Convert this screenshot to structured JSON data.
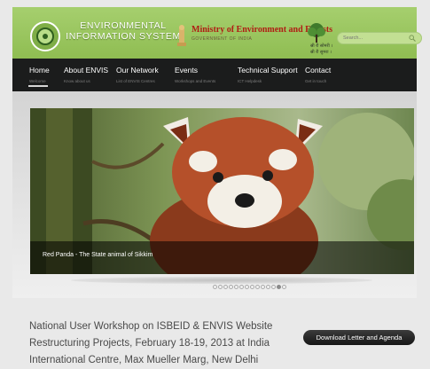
{
  "header": {
    "envis_line1": "ENVIRONMENTAL",
    "envis_line2": "INFORMATION SYSTEM",
    "ministry": "Ministry of Environment and Forests",
    "ministry_sub": "GOVERNMENT OF INDIA",
    "hindi_line1": "स्री री सोमरी ।",
    "hindi_line2": "स्री री सुमरा ।",
    "search_placeholder": "Search...",
    "colors": {
      "header_green": "#a6cf6e",
      "ministry_red": "#b01e14"
    }
  },
  "nav": {
    "items": [
      {
        "label": "Home",
        "sub": "Welcome"
      },
      {
        "label": "About ENVIS",
        "sub": "Know about us"
      },
      {
        "label": "Our Network",
        "sub": "List of ENVIS Centres"
      },
      {
        "label": "Events",
        "sub": "Workshops and Events"
      },
      {
        "label": "Technical Support",
        "sub": "ICT Helpdesk"
      },
      {
        "label": "Contact",
        "sub": "Get in touch"
      }
    ],
    "active": "Home"
  },
  "slider": {
    "caption": "Red Panda - The State animal of Sikkim",
    "slide_count": 14,
    "active_slide": 12
  },
  "news": {
    "line1": "National User Workshop on ISBEID & ENVIS Website",
    "line2": "Restructuring Projects, February 18-19, 2013 at India",
    "line3": "International Centre, Max Mueller Marg, New Delhi",
    "button": "Download Letter and Agenda"
  }
}
